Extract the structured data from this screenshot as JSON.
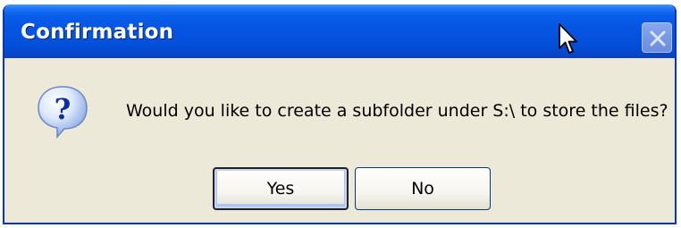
{
  "dialog": {
    "title": "Confirmation",
    "message": "Would you like to create a subfolder under S:\\ to store the files?",
    "icon": "question-icon",
    "buttons": {
      "yes_label": "Yes",
      "no_label": "No"
    },
    "close_icon": "close-icon"
  },
  "colors": {
    "titlebar": "#0554e2",
    "body": "#ece9d8",
    "frame": "#0831d9",
    "button_border": "#003c74"
  }
}
